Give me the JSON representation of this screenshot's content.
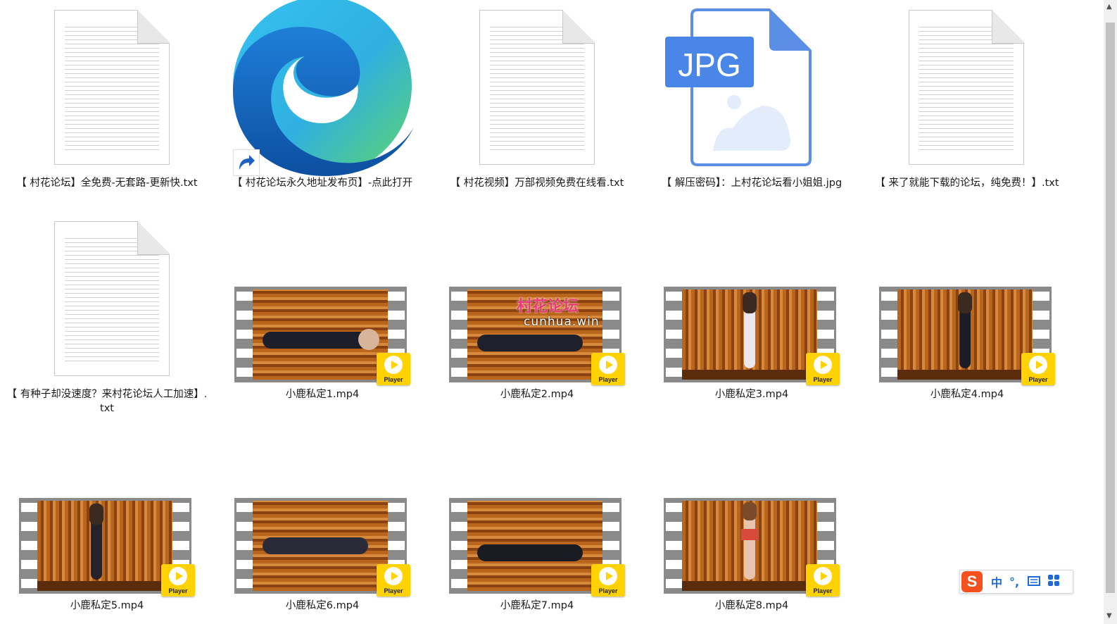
{
  "files": [
    {
      "name": "【 村花论坛】全免费-无套路-更新快.txt",
      "type": "text"
    },
    {
      "name": "【 村花论坛永久地址发布页】-点此打开",
      "type": "shortcut"
    },
    {
      "name": "【 村花视频】万部视频免费在线看.txt",
      "type": "text"
    },
    {
      "name": "【 解压密码】：上村花论坛看小姐姐.jpg",
      "type": "image"
    },
    {
      "name": "【 来了就能下载的论坛，纯免费！】.txt",
      "type": "text"
    },
    {
      "name": "【 有种子却没速度？来村花论坛人工加速】.txt",
      "type": "text"
    },
    {
      "name": "小鹿私定1.mp4",
      "type": "video"
    },
    {
      "name": "小鹿私定2.mp4",
      "type": "video"
    },
    {
      "name": "小鹿私定3.mp4",
      "type": "video"
    },
    {
      "name": "小鹿私定4.mp4",
      "type": "video"
    },
    {
      "name": "小鹿私定5.mp4",
      "type": "video"
    },
    {
      "name": "小鹿私定6.mp4",
      "type": "video"
    },
    {
      "name": "小鹿私定7.mp4",
      "type": "video"
    },
    {
      "name": "小鹿私定8.mp4",
      "type": "video"
    }
  ],
  "jpg_badge": "JPG",
  "player_badge": "Player",
  "watermark": {
    "title": "村花论坛",
    "domain": "cunhua.win"
  },
  "ime": {
    "logo": "S",
    "mode": "中",
    "punct": "°,",
    "keyboard_icon": "keyboard-icon",
    "apps_icon": "grid-icon"
  },
  "colors": {
    "player": "#ffd200",
    "jpg_blue": "#4a86e8",
    "ime_logo": "#f4511e"
  }
}
